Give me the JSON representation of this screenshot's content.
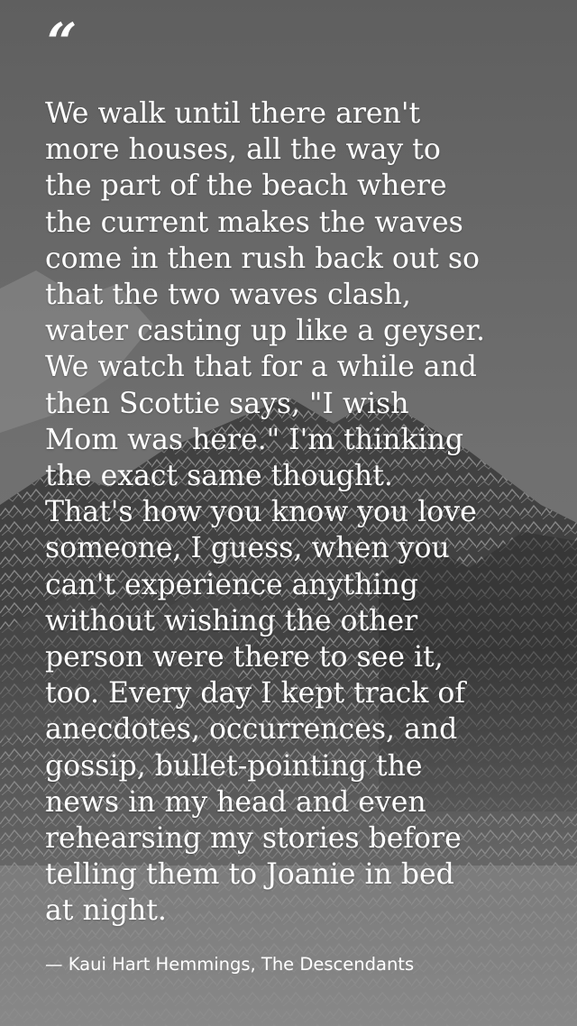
{
  "quote": {
    "mark": "“",
    "text": "We walk until there aren't\nmore houses, all the way to\nthe part of the beach where\nthe current makes the waves\ncome in then rush back out so\nthat the two waves clash,\nwater casting up like a geyser.\nWe watch that for a while and\nthen Scottie says, \"I wish\nMom was here.\" I'm thinking\nthe exact same thought.\nThat's how you know you love\nsomeone, I guess, when you\ncan't experience anything\nwithout wishing the other\nperson were there to see it,\ntoo. Every day I kept track of\nanecdotes, occurrences, and\ngossip, bullet-pointing the\nnews in my head and even\nrehearsing my stories before\ntelling them to Joanie in bed\nat night.",
    "attribution": "— Kaui Hart Hemmings, The Descendants"
  },
  "background": {
    "description_icon": "mountain-background",
    "base_color": "#6e6e6e",
    "text_color": "#ffffff"
  }
}
